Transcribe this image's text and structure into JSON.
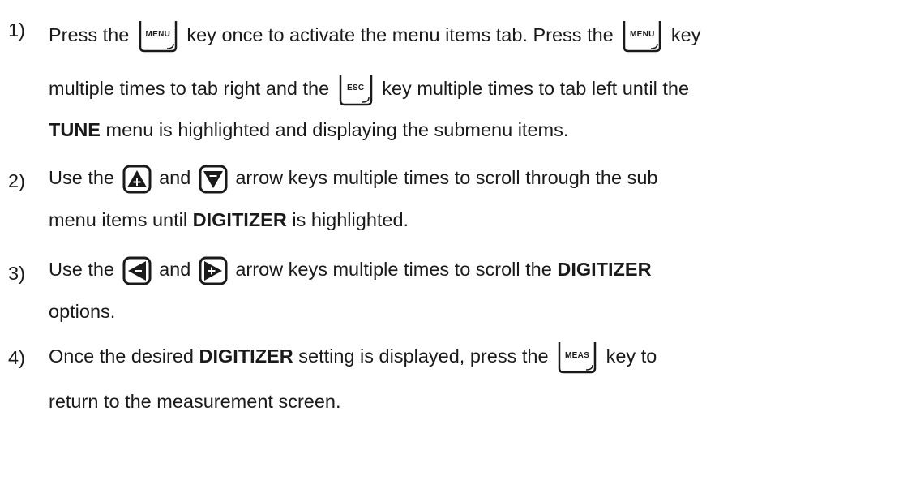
{
  "steps": [
    {
      "number": "1)",
      "lines": [
        [
          "Press the",
          "key once to activate the menu items tab.  Press the",
          "key"
        ],
        [
          "multiple times to tab right and the",
          "key multiple times to tab left until the"
        ],
        [
          "TUNE",
          "menu is highlighted and displaying the submenu items."
        ]
      ]
    },
    {
      "number": "2)",
      "lines": [
        [
          "Use the",
          "and",
          "arrow keys multiple times to scroll through the sub"
        ],
        [
          "menu items until",
          "DIGITIZER",
          "is highlighted."
        ]
      ]
    },
    {
      "number": "3)",
      "lines": [
        [
          "Use the",
          "and",
          "arrow keys multiple times to scroll the",
          "DIGITIZER"
        ],
        [
          "options."
        ]
      ]
    },
    {
      "number": "4)",
      "lines": [
        [
          "Once the desired",
          "DIGITIZER",
          "setting is displayed, press the",
          "key to"
        ],
        [
          "return to the measurement screen."
        ]
      ]
    }
  ],
  "keys": {
    "menu": "MENU",
    "esc": "ESC",
    "meas": "MEAS"
  },
  "icons": {
    "up_arrow": "up-arrow-key-icon",
    "down_arrow": "down-arrow-key-icon",
    "left_arrow": "left-arrow-key-icon",
    "right_arrow": "right-arrow-key-icon"
  }
}
